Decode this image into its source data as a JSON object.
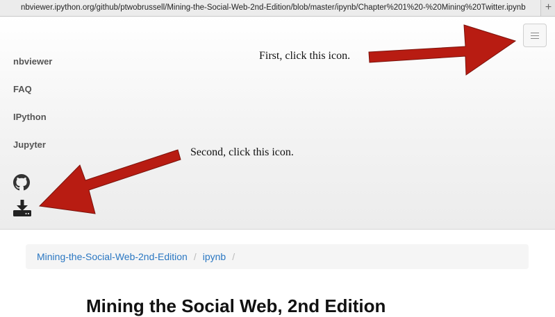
{
  "browser": {
    "url": "nbviewer.ipython.org/github/ptwobrussell/Mining-the-Social-Web-2nd-Edition/blob/master/ipynb/Chapter%201%20-%20Mining%20Twitter.ipynb",
    "new_tab_label": "+"
  },
  "nav": {
    "items": [
      {
        "label": "nbviewer"
      },
      {
        "label": "FAQ"
      },
      {
        "label": "IPython"
      },
      {
        "label": "Jupyter"
      }
    ],
    "icons": [
      "github-icon",
      "download-icon"
    ],
    "toggle_icon": "hamburger-menu-icon"
  },
  "annotations": {
    "first": "First, click this icon.",
    "second": "Second, click this icon.",
    "arrow_color": "#b81c12"
  },
  "breadcrumb": {
    "items": [
      {
        "label": "Mining-the-Social-Web-2nd-Edition"
      },
      {
        "label": "ipynb"
      }
    ],
    "separator": "/"
  },
  "page": {
    "title": "Mining the Social Web, 2nd Edition"
  },
  "colors": {
    "link": "#2a77c2",
    "nav_text": "#555555"
  }
}
